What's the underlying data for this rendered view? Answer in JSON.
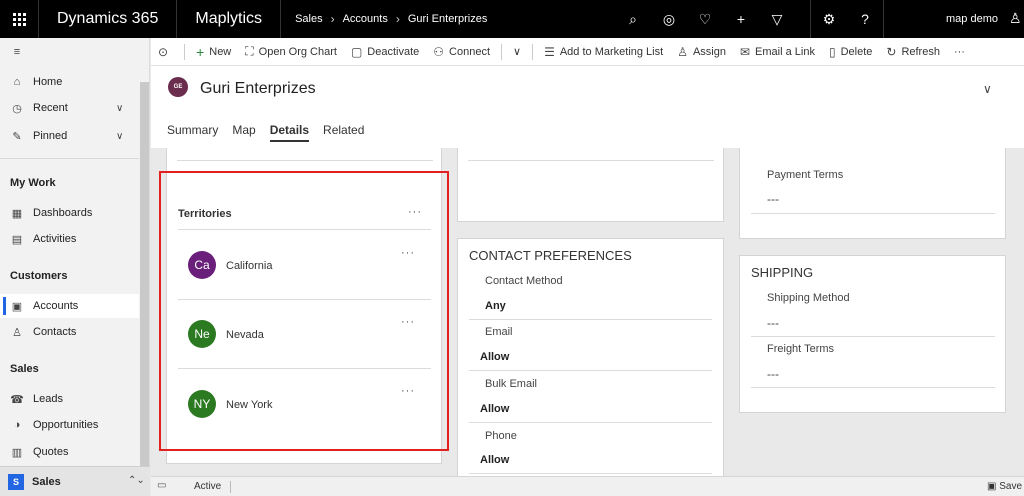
{
  "topbar": {
    "brand": "Dynamics 365",
    "app": "Maplytics",
    "breadcrumbs": [
      "Sales",
      "Accounts",
      "Guri Enterprizes"
    ],
    "actions": [
      {
        "icon": "search-icon",
        "glyph": "⌕"
      },
      {
        "icon": "task-icon",
        "glyph": "◎"
      },
      {
        "icon": "lightbulb-icon",
        "glyph": "♡"
      },
      {
        "icon": "add-icon",
        "glyph": "+"
      },
      {
        "icon": "filter-icon",
        "glyph": "▽"
      }
    ],
    "settings_glyph": "⚙",
    "help_glyph": "?",
    "user_name": "map demo"
  },
  "sidebar": {
    "items": [
      {
        "label": "Home",
        "icon": "home-icon",
        "glyph": "⌂"
      },
      {
        "label": "Recent",
        "icon": "clock-icon",
        "glyph": "◷"
      },
      {
        "label": "Pinned",
        "icon": "pin-icon",
        "glyph": "✎"
      }
    ],
    "groups": [
      {
        "title": "My Work",
        "items": [
          {
            "label": "Dashboards",
            "icon": "dashboard-icon",
            "glyph": "▦"
          },
          {
            "label": "Activities",
            "icon": "activities-icon",
            "glyph": "▤"
          }
        ]
      },
      {
        "title": "Customers",
        "items": [
          {
            "label": "Accounts",
            "icon": "building-icon",
            "glyph": "▣"
          },
          {
            "label": "Contacts",
            "icon": "person-icon",
            "glyph": "♙"
          }
        ]
      },
      {
        "title": "Sales",
        "items": [
          {
            "label": "Leads",
            "icon": "phone-icon",
            "glyph": "☎"
          },
          {
            "label": "Opportunities",
            "icon": "opportunity-icon",
            "glyph": "◑"
          },
          {
            "label": "Quotes",
            "icon": "quote-icon",
            "glyph": "▥"
          }
        ]
      }
    ],
    "area": {
      "badge": "S",
      "label": "Sales"
    }
  },
  "commands": [
    {
      "label": "New",
      "icon": "plus-icon",
      "glyph": "+"
    },
    {
      "label": "Open Org Chart",
      "icon": "org-chart-icon",
      "glyph": "⛶"
    },
    {
      "label": "Deactivate",
      "icon": "deactivate-icon",
      "glyph": "▢"
    },
    {
      "label": "Connect",
      "icon": "connect-icon",
      "glyph": "⚇"
    },
    {
      "label": "Add to Marketing List",
      "icon": "list-add-icon",
      "glyph": "☰"
    },
    {
      "label": "Assign",
      "icon": "assign-icon",
      "glyph": "♙"
    },
    {
      "label": "Email a Link",
      "icon": "email-icon",
      "glyph": "✉"
    },
    {
      "label": "Delete",
      "icon": "trash-icon",
      "glyph": "▯"
    },
    {
      "label": "Refresh",
      "icon": "refresh-icon",
      "glyph": "↻"
    }
  ],
  "record": {
    "initials": "GE",
    "title": "Guri Enterprizes",
    "avatar_color": "#6b2d4e",
    "tabs": [
      "Summary",
      "Map",
      "Details",
      "Related"
    ],
    "active_tab": "Details"
  },
  "territories": {
    "title": "Territories",
    "items": [
      {
        "initials": "Ca",
        "name": "California",
        "color": "#6a1f7a"
      },
      {
        "initials": "Ne",
        "name": "Nevada",
        "color": "#2b7a22"
      },
      {
        "initials": "NY",
        "name": "New York",
        "color": "#2b7a22"
      }
    ]
  },
  "contact_preferences": {
    "title": "CONTACT PREFERENCES",
    "fields": [
      {
        "label": "Contact Method",
        "value": "Any"
      },
      {
        "label": "Email",
        "value": "Allow"
      },
      {
        "label": "Bulk Email",
        "value": "Allow"
      },
      {
        "label": "Phone",
        "value": "Allow"
      }
    ]
  },
  "billing": {
    "payment_terms_label": "Payment Terms",
    "payment_terms_value": "---"
  },
  "shipping": {
    "title": "SHIPPING",
    "fields": [
      {
        "label": "Shipping Method",
        "value": "---"
      },
      {
        "label": "Freight Terms",
        "value": "---"
      }
    ]
  },
  "status": {
    "state": "Active",
    "save_label": "Save"
  }
}
